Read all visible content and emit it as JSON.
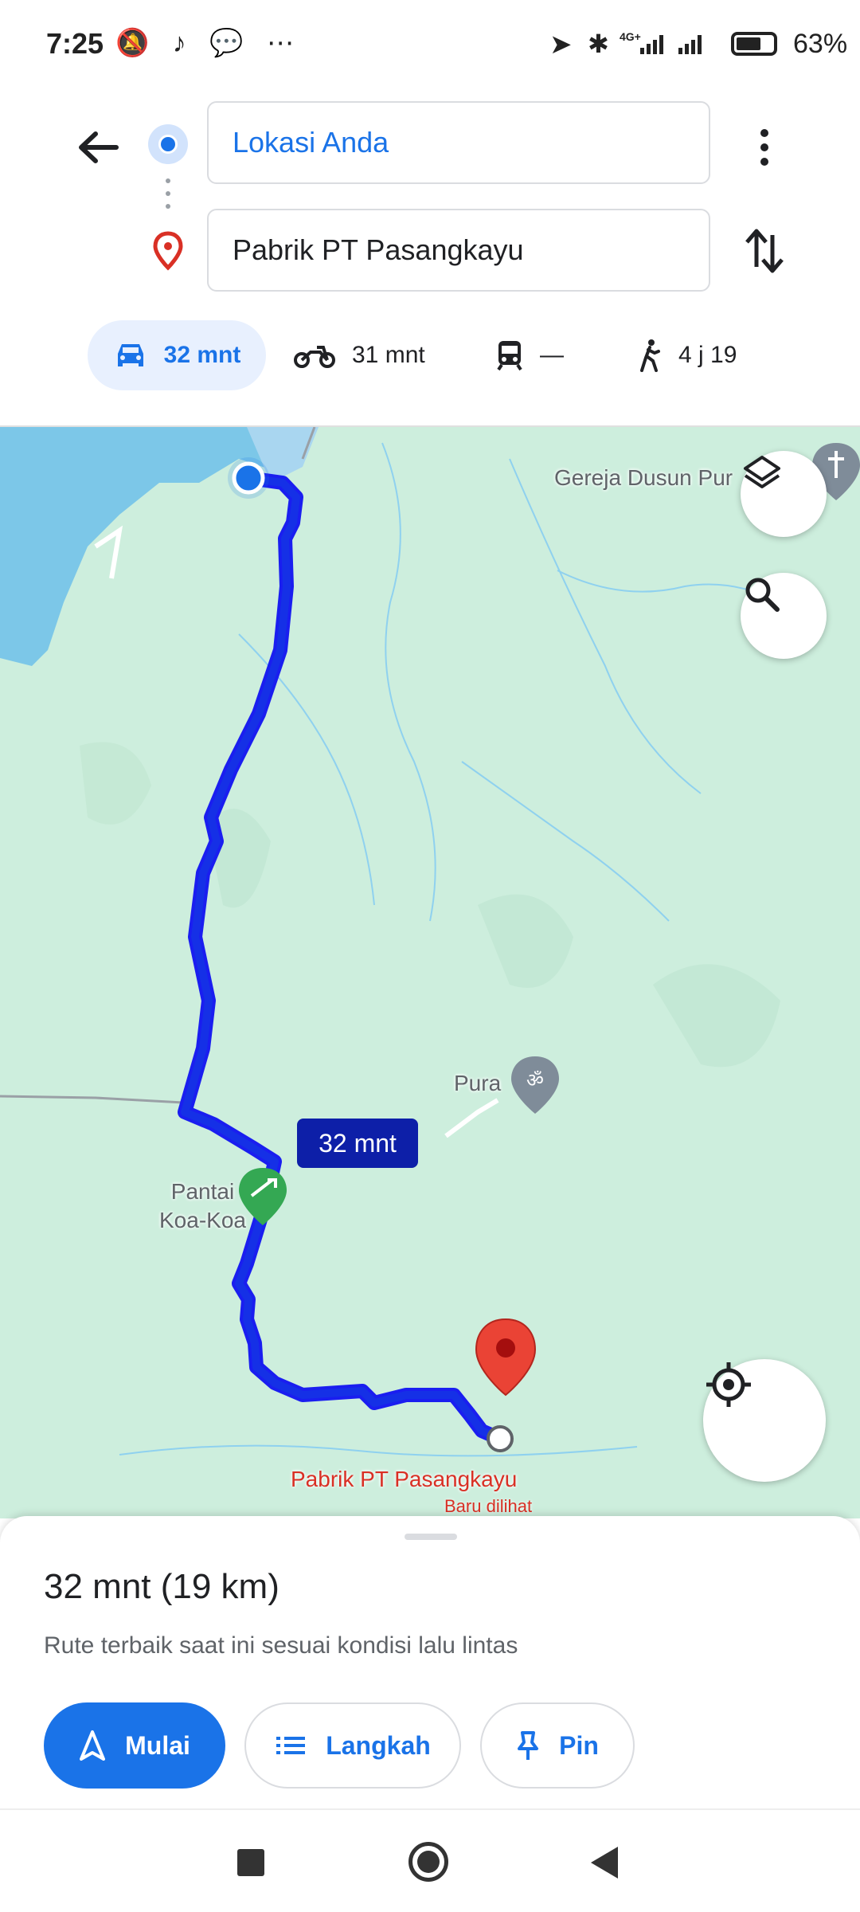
{
  "status_bar": {
    "time": "7:25",
    "left_icons": "🔕 ♪ 💬 ⋯",
    "network": "4G+",
    "battery_pct": "63%",
    "battery_level": 0.63
  },
  "directions": {
    "origin": "Lokasi Anda",
    "destination": "Pabrik PT Pasangkayu",
    "origin_icon": "origin-dot-icon",
    "destination_icon": "place-pin-icon"
  },
  "modes": [
    {
      "name": "car",
      "icon": "car-icon",
      "label": "32 mnt",
      "selected": true
    },
    {
      "name": "motorcycle",
      "icon": "motorcycle-icon",
      "label": "31 mnt",
      "selected": false
    },
    {
      "name": "transit",
      "icon": "train-icon",
      "label": "—",
      "selected": false
    },
    {
      "name": "walk",
      "icon": "walk-icon",
      "label": "4 j 19",
      "selected": false
    }
  ],
  "map": {
    "labels": {
      "church": "Gereja Dusun Pur",
      "temple": "Pura",
      "beach": "Pantai\nKoa-Koa",
      "destination": "Pabrik PT Pasangkayu",
      "destination_sub": "Baru dilihat"
    },
    "route_duration": "32 mnt",
    "route_color": "#1a1ef0",
    "water_color": "#7cc7e8",
    "land_color": "#cdeedd"
  },
  "sheet": {
    "summary": "32 mnt (19 km)",
    "subtitle": "Rute terbaik saat ini sesuai kondisi lalu lintas",
    "start_label": "Mulai",
    "steps_label": "Langkah",
    "pin_label": "Pin"
  },
  "colors": {
    "accent": "#1a73e8",
    "destination_red": "#d93025"
  }
}
